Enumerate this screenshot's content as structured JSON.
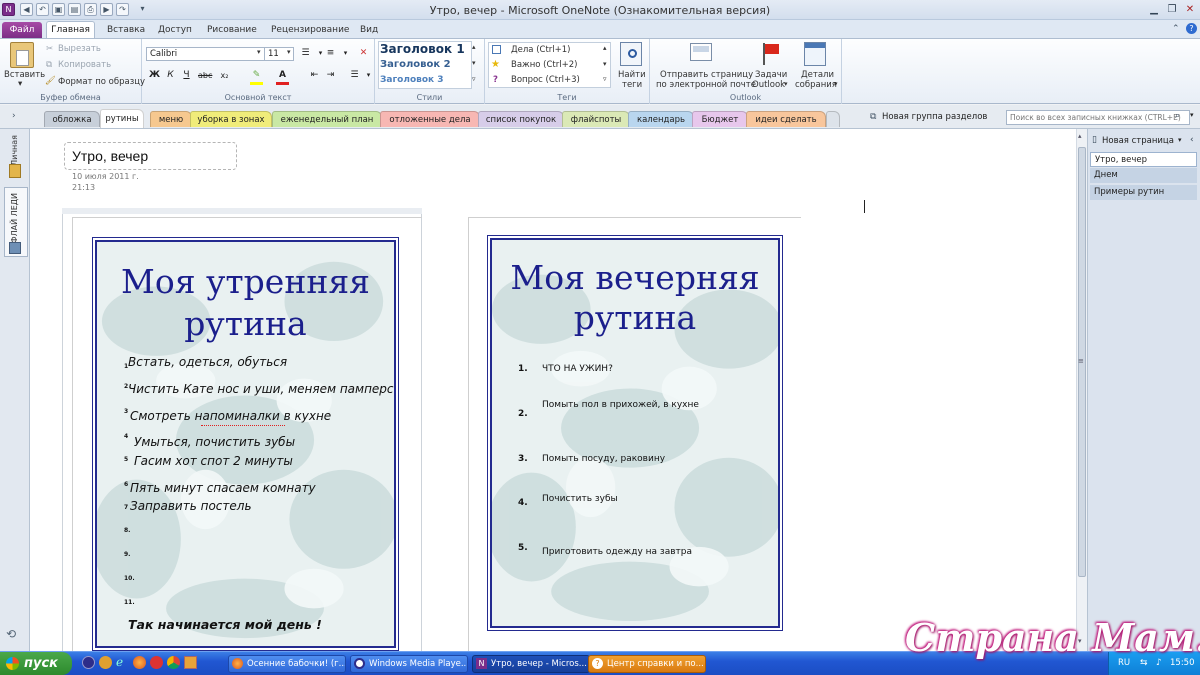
{
  "window": {
    "title": "Утро, вечер  -  Microsoft OneNote (Ознакомительная версия)"
  },
  "ribbon_tabs": {
    "file": "Файл",
    "home": "Главная",
    "insert": "Вставка",
    "share": "Доступ",
    "draw": "Рисование",
    "review": "Рецензирование",
    "view": "Вид"
  },
  "clipboard": {
    "paste": "Вставить",
    "cut": "Вырезать",
    "copy": "Копировать",
    "format_painter": "Формат по образцу",
    "label": "Буфер обмена"
  },
  "basic_text": {
    "font": "Calibri",
    "size": "11",
    "label": "Основной текст"
  },
  "styles": {
    "h1": "Заголовок 1",
    "h2": "Заголовок 2",
    "h3": "Заголовок 3",
    "label": "Стили"
  },
  "tags": {
    "todo": "Дела (Ctrl+1)",
    "important": "Важно (Ctrl+2)",
    "question": "Вопрос (Ctrl+3)",
    "find_tags": "Найти теги",
    "label": "Теги"
  },
  "outlook": {
    "email": "Отправить страницу по электронной почте",
    "email_l1": "Отправить страницу",
    "email_l2": "по электронной почте",
    "tasks_l1": "Задачи",
    "tasks_l2": "Outlook",
    "meeting_l1": "Детали",
    "meeting_l2": "собрания",
    "label": "Outlook"
  },
  "sections": [
    "обложка",
    "рутины",
    "меню",
    "уборка в зонах",
    "еженедельный план",
    "отложенные дела",
    "список покупок",
    "флайспоты",
    "календарь",
    "Бюджет",
    "идеи сделать"
  ],
  "new_section_group": "Новая группа разделов",
  "search": {
    "placeholder": "Поиск во всех записных книжках (CTRL+E)"
  },
  "notebooks": {
    "personal": "Личная",
    "flylady": "ФЛАЙ ЛЕДИ"
  },
  "page": {
    "title": "Утро, вечер",
    "date": "10 июля 2011 г.",
    "time": "21:13"
  },
  "pages_panel": {
    "new_page": "Новая страница",
    "items": [
      "Утро, вечер",
      "Днем",
      "Примеры рутин"
    ]
  },
  "morning": {
    "title_l1": "Моя утренняя",
    "title_l2": "рутина",
    "items": [
      "Встать, одеться, обуться",
      "Чистить Кате нос и уши, меняем памперс",
      "Смотреть напоминалки в кухне",
      "Умыться, почистить зубы",
      "Гасим хот спот 2 минуты",
      "Пять минут спасаем комнату",
      "Заправить постель",
      "",
      "",
      "",
      ""
    ],
    "numbers": [
      "1",
      "2",
      "3",
      "4",
      "5",
      "6",
      "7",
      "8.",
      "9.",
      "10.",
      "11."
    ],
    "footer": "Так начинается  мой день  !"
  },
  "evening": {
    "title_l1": "Моя вечерняя",
    "title_l2": "рутина",
    "items": [
      "ЧТО НА УЖИН?",
      "Помыть пол в прихожей, в кухне",
      "Помыть посуду, раковину",
      "Почистить зубы",
      "Приготовить одежду на завтра"
    ],
    "numbers": [
      "1.",
      "2.",
      "3.",
      "4.",
      "5."
    ]
  },
  "taskbar": {
    "start": "пуск",
    "buttons": [
      "Осенние бабочки! (г...",
      "Windows Media Playe...",
      "Утро, вечер - Micros...",
      "Центр справки и по..."
    ],
    "lang": "RU",
    "clock": "15:50"
  },
  "watermark": "Страна Мам.ру",
  "colors": {
    "title_blue": "#1b1f8c",
    "file_tab": "#8a3591",
    "taskbar": "#245edb"
  }
}
